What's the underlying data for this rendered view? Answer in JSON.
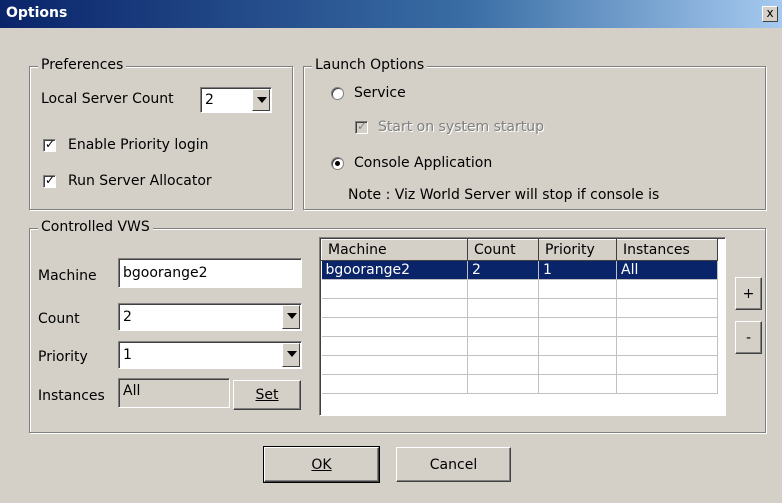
{
  "window": {
    "title": "Options",
    "close_label": "x"
  },
  "preferences": {
    "legend": "Preferences",
    "local_server_count_label": "Local Server Count",
    "local_server_count_value": "2",
    "enable_priority_login_label": "Enable Priority login",
    "enable_priority_login_checked": true,
    "run_server_allocator_label": "Run Server Allocator",
    "run_server_allocator_checked": true
  },
  "launch": {
    "legend": "Launch Options",
    "service_label": "Service",
    "start_on_startup_label": "Start on system startup",
    "console_label": "Console Application",
    "selected": "console",
    "note": "Note : Viz World Server will stop if console is"
  },
  "controlled": {
    "legend": "Controlled VWS",
    "machine_label": "Machine",
    "machine_value": "bgoorange2",
    "count_label": "Count",
    "count_value": "2",
    "priority_label": "Priority",
    "priority_value": "1",
    "instances_label": "Instances",
    "instances_value": "All",
    "set_label": "Set",
    "add_label": "+",
    "remove_label": "-",
    "table": {
      "columns": [
        "Machine",
        "Count",
        "Priority",
        "Instances"
      ],
      "rows": [
        [
          "bgoorange2",
          "2",
          "1",
          "All"
        ]
      ]
    }
  },
  "buttons": {
    "ok": "OK",
    "cancel": "Cancel"
  },
  "colors": {
    "title_bar": "#0a246a",
    "selection": "#0a246a",
    "face": "#d4d0c8"
  }
}
